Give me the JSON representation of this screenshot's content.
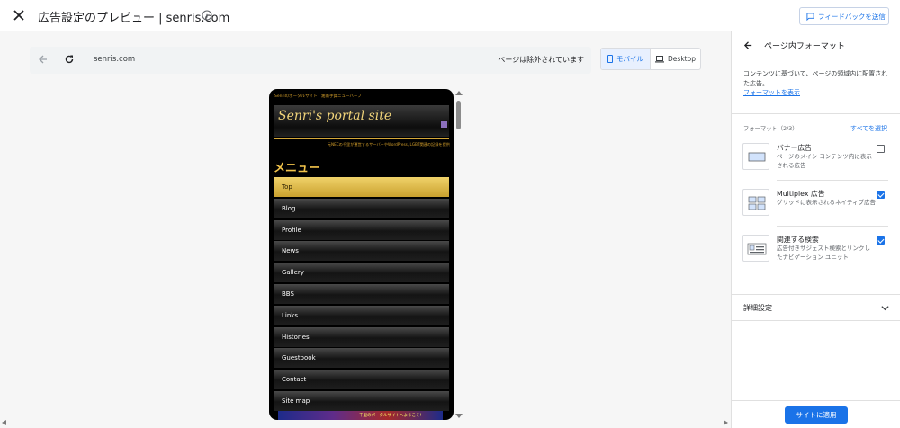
{
  "header": {
    "title": "広告設定のプレビュー | senris.com",
    "feedback_label": "フィードバックを送信"
  },
  "address_bar": {
    "url": "senris.com",
    "status": "ページは除外されています"
  },
  "device_switch": {
    "mobile_label": "モバイル",
    "desktop_label": "Desktop",
    "selected": "モバイル"
  },
  "preview": {
    "tagline": "Senriのポータルサイト | 湘南手賀ニューハーフ",
    "site_name": "Senri's portal site",
    "subtitle": "元NECの千里が運営するサーバーやWordPress, LGBT関連の記録を提供",
    "menu_title": "メニュー",
    "menu_items": [
      "Top",
      "Blog",
      "Profile",
      "News",
      "Gallery",
      "BBS",
      "Links",
      "Histories",
      "Guestbook",
      "Contact",
      "Site map"
    ],
    "active_item": "Top",
    "footer_banner_text": "千里のポータルサイトへようこそ!"
  },
  "panel": {
    "title": "ページ内フォーマット",
    "description": "コンテンツに基づいて、ページの領域内に配置された広告。",
    "show_formats_link": "フォーマットを表示",
    "formats_heading": "フォーマット（2/3）",
    "select_all": "すべてを選択",
    "formats": [
      {
        "name": "バナー広告",
        "desc": "ページのメイン コンテンツ内に表示される広告",
        "checked": false,
        "icon": "banner-icon"
      },
      {
        "name": "Multiplex 広告",
        "desc": "グリッドに表示されるネイティブ広告",
        "checked": true,
        "icon": "multiplex-icon"
      },
      {
        "name": "関連する検索",
        "desc": "広告付きサジェスト検索とリンクしたナビゲーション ユニット",
        "checked": true,
        "icon": "related-search-icon"
      }
    ],
    "advanced_label": "詳細設定",
    "apply_label": "サイトに適用"
  },
  "colors": {
    "accent": "#1a73e8",
    "menu_active": "#d9b34a",
    "site_gold": "#f1d47a"
  }
}
